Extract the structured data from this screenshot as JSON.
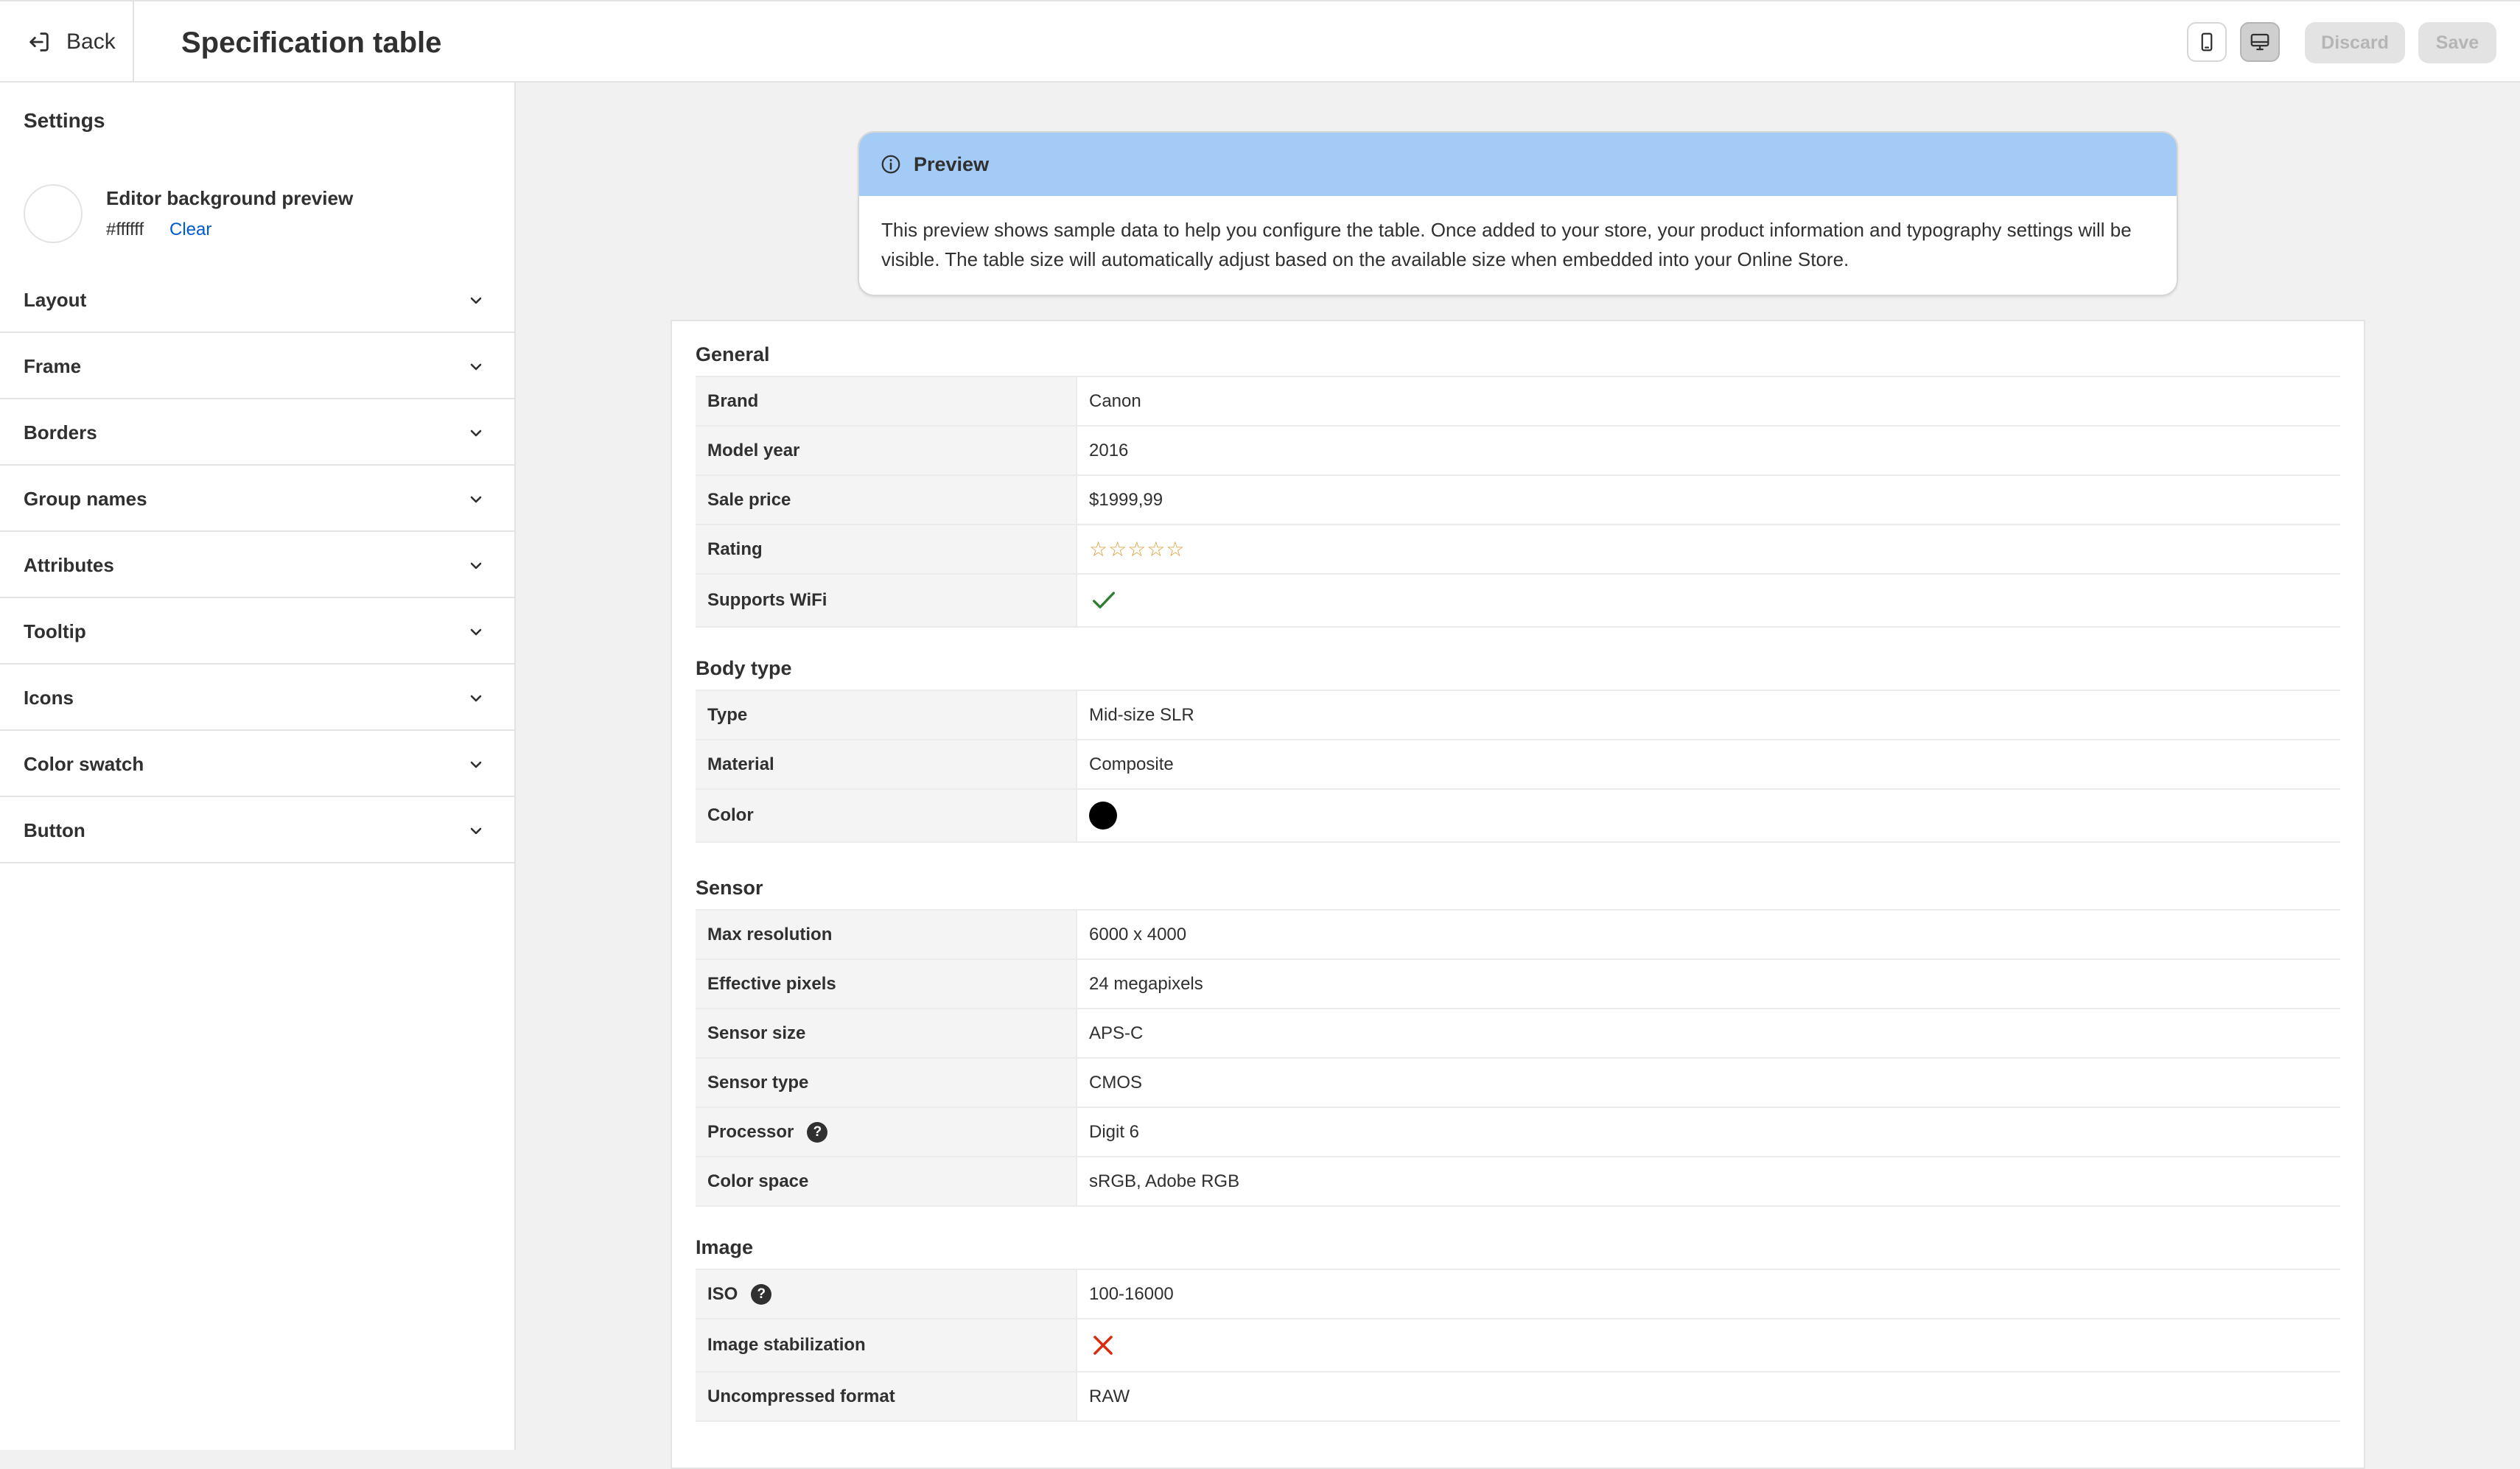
{
  "header": {
    "back_label": "Back",
    "title": "Specification table",
    "view_mobile_icon": "mobile-icon",
    "view_desktop_icon": "desktop-icon",
    "discard_label": "Discard",
    "save_label": "Save"
  },
  "sidebar": {
    "heading": "Settings",
    "bg_preview": {
      "label": "Editor background preview",
      "value": "#ffffff",
      "clear_label": "Clear"
    },
    "sections": [
      {
        "label": "Layout"
      },
      {
        "label": "Frame"
      },
      {
        "label": "Borders"
      },
      {
        "label": "Group names"
      },
      {
        "label": "Attributes"
      },
      {
        "label": "Tooltip"
      },
      {
        "label": "Icons"
      },
      {
        "label": "Color swatch"
      },
      {
        "label": "Button"
      }
    ]
  },
  "banner": {
    "title": "Preview",
    "icon": "info-icon",
    "body": "This preview shows sample data to help you configure the table. Once added to your store, your product information and typography settings will be visible. The table size will automatically adjust based on the available size when embedded into your Online Store."
  },
  "table": {
    "groups": [
      {
        "title": "General",
        "rows": [
          {
            "key": "Brand",
            "value": "Canon"
          },
          {
            "key": "Model year",
            "value": "2016"
          },
          {
            "key": "Sale price",
            "value": "$1999,99"
          },
          {
            "key": "Rating",
            "value": "☆☆☆☆☆"
          },
          {
            "key": "Supports WiFi",
            "icon": "checkmark-icon"
          }
        ]
      },
      {
        "title": "Body type",
        "rows": [
          {
            "key": "Type",
            "value": "Mid-size SLR"
          },
          {
            "key": "Material",
            "value": "Composite"
          },
          {
            "key": "Color",
            "swatch": "#000000"
          }
        ]
      },
      {
        "title": "Sensor",
        "rows": [
          {
            "key": "Max resolution",
            "value": "6000 x 4000"
          },
          {
            "key": "Effective pixels",
            "value": "24 megapixels"
          },
          {
            "key": "Sensor size",
            "value": "APS-C"
          },
          {
            "key": "Sensor type",
            "value": "CMOS"
          },
          {
            "key": "Processor",
            "value": "Digit 6",
            "help": "?"
          },
          {
            "key": "Color space",
            "value": "sRGB, Adobe RGB"
          }
        ]
      },
      {
        "title": "Image",
        "rows": [
          {
            "key": "ISO",
            "value": "100-16000",
            "help": "?"
          },
          {
            "key": "Image stabilization",
            "icon": "cross-icon"
          },
          {
            "key": "Uncompressed format",
            "value": "RAW"
          }
        ]
      }
    ]
  },
  "colors": {
    "accent_link": "#005bd3",
    "banner_header": "#a3cbf6",
    "check_green": "#2e7d32",
    "cross_red": "#d82c0d",
    "star_gold": "#d9a13a"
  }
}
